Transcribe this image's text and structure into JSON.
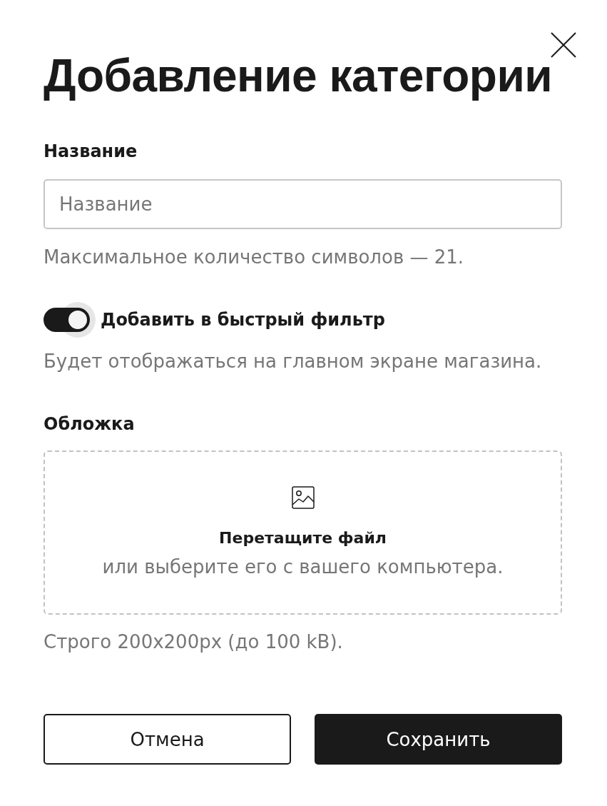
{
  "dialog": {
    "title": "Добавление категории",
    "name_field": {
      "label": "Название",
      "placeholder": "Название",
      "hint": "Максимальное количество символов — 21."
    },
    "quick_filter": {
      "label": "Добавить в быстрый фильтр",
      "on": true,
      "focused": true,
      "hint": "Будет отображаться на главном экране магазина."
    },
    "cover": {
      "label": "Обложка",
      "dropzone": {
        "title": "Перетащите файл",
        "subtitle": "или выберите его с вашего компьютера."
      },
      "hint": "Строго 200x200px (до 100 kB)."
    },
    "buttons": [
      {
        "label": "Отмена",
        "kind": "secondary"
      },
      {
        "label": "Сохранить",
        "kind": "primary"
      }
    ]
  }
}
